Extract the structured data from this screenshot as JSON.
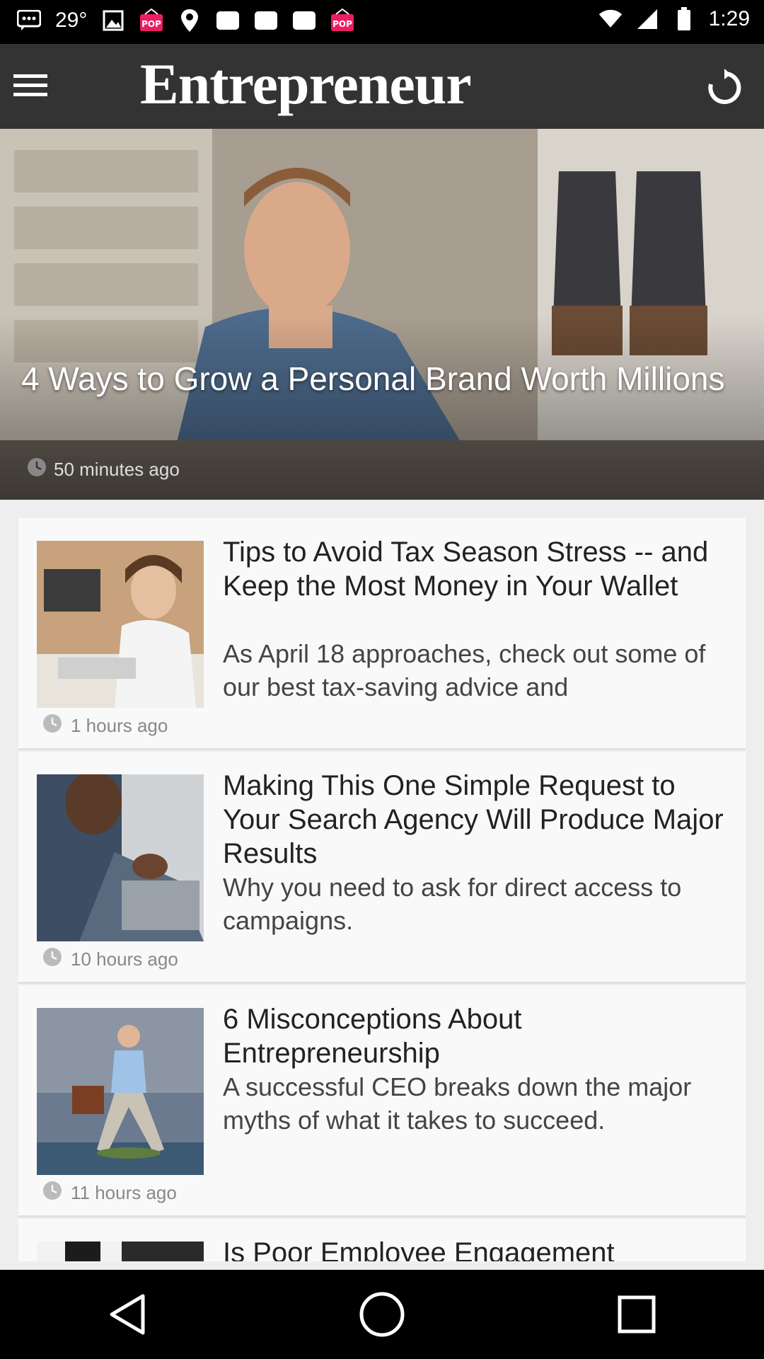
{
  "status_bar": {
    "temperature": "29°",
    "time": "1:29",
    "left_icons": [
      "message-icon",
      "temperature-icon",
      "image-icon",
      "pop-app-icon",
      "location-icon",
      "rect-icon",
      "rect-icon",
      "rect-icon",
      "pop-app-icon"
    ],
    "right_icons": [
      "wifi-icon",
      "signal-icon",
      "battery-icon"
    ]
  },
  "app_bar": {
    "logo_text": "Entrepreneur",
    "menu_icon": "hamburger-menu-icon",
    "refresh_icon": "refresh-icon"
  },
  "hero": {
    "title": "4 Ways to Grow a Personal Brand Worth Millions",
    "time": "50 minutes ago"
  },
  "articles": [
    {
      "title": "Tips to Avoid Tax Season Stress -- and Keep the Most Money in Your Wallet",
      "description": "As April 18 approaches, check out some of our best tax-saving advice and",
      "time": "1 hours ago"
    },
    {
      "title": "Making This One Simple Request to Your Search Agency Will Produce Major Results",
      "description": "Why you need to ask for direct access to campaigns.",
      "time": "10 hours ago"
    },
    {
      "title": "6 Misconceptions About Entrepreneurship",
      "description": "A successful CEO breaks down the major myths of what it takes to succeed.",
      "time": "11 hours ago"
    },
    {
      "title": "Is Poor Employee Engagement",
      "description": "",
      "time": ""
    }
  ],
  "nav_bar": {
    "icons": [
      "back-icon",
      "home-icon",
      "recents-icon"
    ]
  },
  "colors": {
    "app_bar": "#333333",
    "background": "#eeeeee",
    "card": "#f9f9f9"
  }
}
